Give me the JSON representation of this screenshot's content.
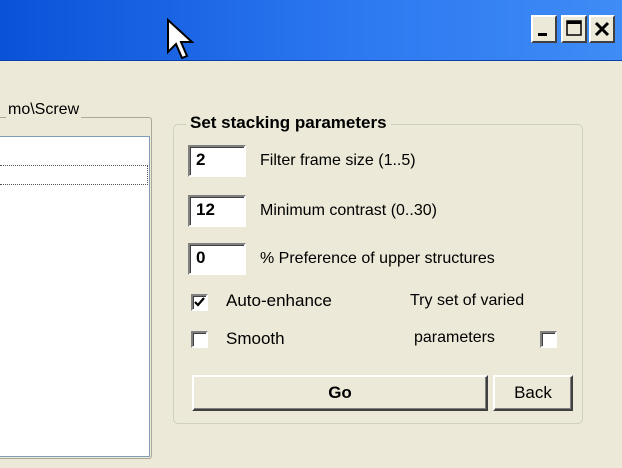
{
  "window": {
    "controls": {
      "minimize": "minimize-icon",
      "maximize": "maximize-icon",
      "close": "close-icon"
    },
    "titlebar_color": "#2b77f0"
  },
  "left_pane": {
    "legend": "mo\\Screw"
  },
  "stacking": {
    "title": "Set stacking parameters",
    "params": [
      {
        "value": "2",
        "label": "Filter frame size (1..5)"
      },
      {
        "value": "12",
        "label": "Minimum contrast (0..30)"
      },
      {
        "value": "0",
        "label": "% Preference of upper  structures"
      }
    ],
    "auto_enhance": {
      "label": "Auto-enhance",
      "checked": true
    },
    "smooth": {
      "label": "Smooth",
      "checked": false
    },
    "try_varied": {
      "line1": "Try set of varied",
      "line2": "parameters",
      "checked": false
    },
    "go_label": "Go",
    "back_label": "Back"
  }
}
